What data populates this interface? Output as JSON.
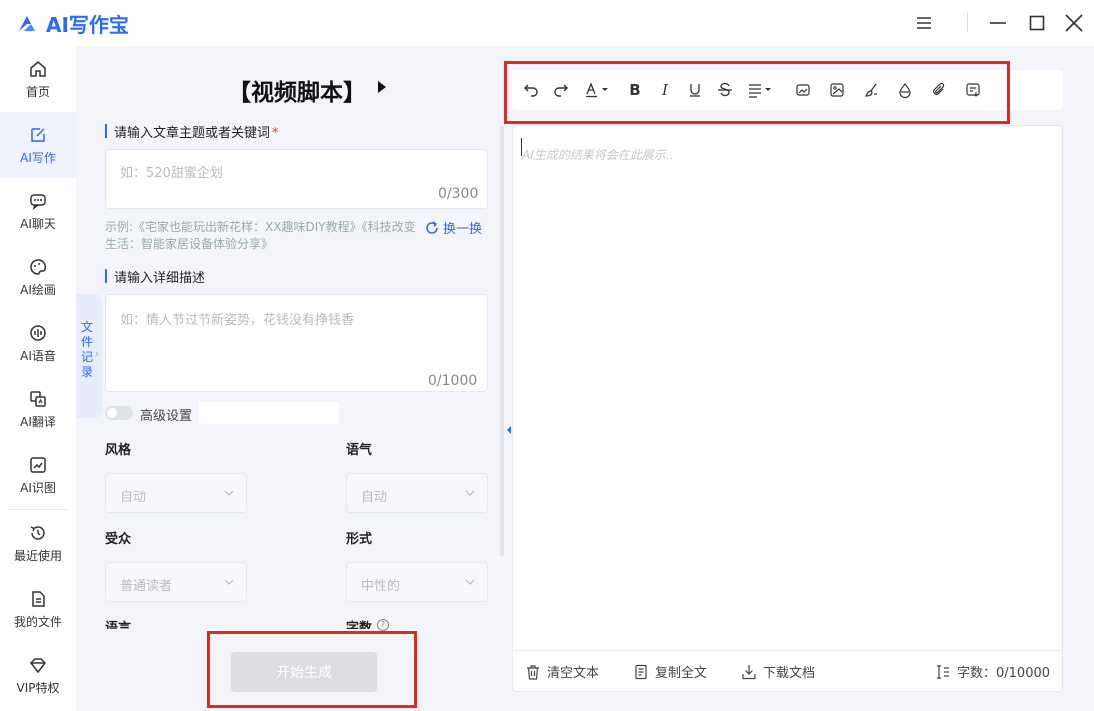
{
  "app": {
    "title": "AI写作宝"
  },
  "nav": {
    "items": [
      {
        "label": "首页",
        "icon": "home-icon"
      },
      {
        "label": "AI写作",
        "icon": "edit-icon"
      },
      {
        "label": "AI聊天",
        "icon": "chat-icon"
      },
      {
        "label": "AI绘画",
        "icon": "palette-icon"
      },
      {
        "label": "AI语音",
        "icon": "audio-icon"
      },
      {
        "label": "AI翻译",
        "icon": "translate-icon"
      },
      {
        "label": "AI识图",
        "icon": "image-recognition-icon"
      },
      {
        "label": "最近使用",
        "icon": "history-icon"
      },
      {
        "label": "我的文件",
        "icon": "file-icon"
      },
      {
        "label": "VIP特权",
        "icon": "diamond-icon"
      }
    ],
    "active_index": 1
  },
  "form": {
    "title": "【视频脚本】",
    "topic_label": "请输入文章主题或者关键词",
    "topic_required_mark": "*",
    "topic_placeholder": "如：520甜蜜企划",
    "topic_counter": "0/300",
    "example_text": "示例:《宅家也能玩出新花样：XX趣味DIY教程》《科技改变生活：智能家居设备体验分享》",
    "swap_label": "换一换",
    "side_tab_label": "文件记录",
    "detail_label": "请输入详细描述",
    "detail_placeholder": "如：情人节过节新姿势，花钱没有挣钱香",
    "detail_counter": "0/1000",
    "advanced_label": "高级设置",
    "fields": {
      "style": {
        "label": "风格",
        "value": "自动"
      },
      "tone": {
        "label": "语气",
        "value": "自动"
      },
      "audience": {
        "label": "受众",
        "value": "普通读者"
      },
      "form": {
        "label": "形式",
        "value": "中性的"
      },
      "language": {
        "label": "语言"
      },
      "word_count": {
        "label": "字数"
      }
    },
    "generate_button": "开始生成"
  },
  "editor": {
    "placeholder": "AI生成的结果将会在此展示..",
    "toolbar_icons": [
      "undo-icon",
      "redo-icon",
      "font-color-icon",
      "bold-icon",
      "italic-icon",
      "underline-icon",
      "strikethrough-icon",
      "align-icon",
      "image-icon",
      "image-frame-icon",
      "brush-icon",
      "drop-icon",
      "attachment-icon",
      "format-icon"
    ],
    "footer": {
      "clear": "清空文本",
      "copy": "复制全文",
      "download": "下载文档",
      "word_count": "字数：0/10000"
    }
  },
  "colors": {
    "accent": "#2d6bf5",
    "highlight": "#e8261b"
  }
}
